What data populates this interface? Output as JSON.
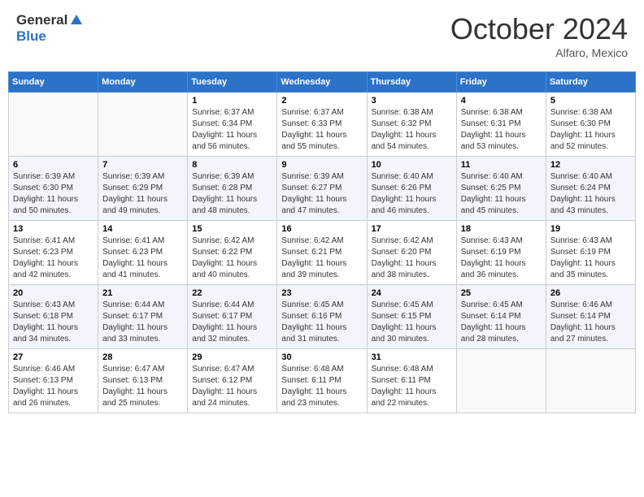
{
  "header": {
    "logo_general": "General",
    "logo_blue": "Blue",
    "month": "October 2024",
    "location": "Alfaro, Mexico"
  },
  "weekdays": [
    "Sunday",
    "Monday",
    "Tuesday",
    "Wednesday",
    "Thursday",
    "Friday",
    "Saturday"
  ],
  "weeks": [
    [
      {
        "day": "",
        "info": ""
      },
      {
        "day": "",
        "info": ""
      },
      {
        "day": "1",
        "sunrise": "6:37 AM",
        "sunset": "6:34 PM",
        "daylight": "11 hours and 56 minutes."
      },
      {
        "day": "2",
        "sunrise": "6:37 AM",
        "sunset": "6:33 PM",
        "daylight": "11 hours and 55 minutes."
      },
      {
        "day": "3",
        "sunrise": "6:38 AM",
        "sunset": "6:32 PM",
        "daylight": "11 hours and 54 minutes."
      },
      {
        "day": "4",
        "sunrise": "6:38 AM",
        "sunset": "6:31 PM",
        "daylight": "11 hours and 53 minutes."
      },
      {
        "day": "5",
        "sunrise": "6:38 AM",
        "sunset": "6:30 PM",
        "daylight": "11 hours and 52 minutes."
      }
    ],
    [
      {
        "day": "6",
        "sunrise": "6:39 AM",
        "sunset": "6:30 PM",
        "daylight": "11 hours and 50 minutes."
      },
      {
        "day": "7",
        "sunrise": "6:39 AM",
        "sunset": "6:29 PM",
        "daylight": "11 hours and 49 minutes."
      },
      {
        "day": "8",
        "sunrise": "6:39 AM",
        "sunset": "6:28 PM",
        "daylight": "11 hours and 48 minutes."
      },
      {
        "day": "9",
        "sunrise": "6:39 AM",
        "sunset": "6:27 PM",
        "daylight": "11 hours and 47 minutes."
      },
      {
        "day": "10",
        "sunrise": "6:40 AM",
        "sunset": "6:26 PM",
        "daylight": "11 hours and 46 minutes."
      },
      {
        "day": "11",
        "sunrise": "6:40 AM",
        "sunset": "6:25 PM",
        "daylight": "11 hours and 45 minutes."
      },
      {
        "day": "12",
        "sunrise": "6:40 AM",
        "sunset": "6:24 PM",
        "daylight": "11 hours and 43 minutes."
      }
    ],
    [
      {
        "day": "13",
        "sunrise": "6:41 AM",
        "sunset": "6:23 PM",
        "daylight": "11 hours and 42 minutes."
      },
      {
        "day": "14",
        "sunrise": "6:41 AM",
        "sunset": "6:23 PM",
        "daylight": "11 hours and 41 minutes."
      },
      {
        "day": "15",
        "sunrise": "6:42 AM",
        "sunset": "6:22 PM",
        "daylight": "11 hours and 40 minutes."
      },
      {
        "day": "16",
        "sunrise": "6:42 AM",
        "sunset": "6:21 PM",
        "daylight": "11 hours and 39 minutes."
      },
      {
        "day": "17",
        "sunrise": "6:42 AM",
        "sunset": "6:20 PM",
        "daylight": "11 hours and 38 minutes."
      },
      {
        "day": "18",
        "sunrise": "6:43 AM",
        "sunset": "6:19 PM",
        "daylight": "11 hours and 36 minutes."
      },
      {
        "day": "19",
        "sunrise": "6:43 AM",
        "sunset": "6:19 PM",
        "daylight": "11 hours and 35 minutes."
      }
    ],
    [
      {
        "day": "20",
        "sunrise": "6:43 AM",
        "sunset": "6:18 PM",
        "daylight": "11 hours and 34 minutes."
      },
      {
        "day": "21",
        "sunrise": "6:44 AM",
        "sunset": "6:17 PM",
        "daylight": "11 hours and 33 minutes."
      },
      {
        "day": "22",
        "sunrise": "6:44 AM",
        "sunset": "6:17 PM",
        "daylight": "11 hours and 32 minutes."
      },
      {
        "day": "23",
        "sunrise": "6:45 AM",
        "sunset": "6:16 PM",
        "daylight": "11 hours and 31 minutes."
      },
      {
        "day": "24",
        "sunrise": "6:45 AM",
        "sunset": "6:15 PM",
        "daylight": "11 hours and 30 minutes."
      },
      {
        "day": "25",
        "sunrise": "6:45 AM",
        "sunset": "6:14 PM",
        "daylight": "11 hours and 28 minutes."
      },
      {
        "day": "26",
        "sunrise": "6:46 AM",
        "sunset": "6:14 PM",
        "daylight": "11 hours and 27 minutes."
      }
    ],
    [
      {
        "day": "27",
        "sunrise": "6:46 AM",
        "sunset": "6:13 PM",
        "daylight": "11 hours and 26 minutes."
      },
      {
        "day": "28",
        "sunrise": "6:47 AM",
        "sunset": "6:13 PM",
        "daylight": "11 hours and 25 minutes."
      },
      {
        "day": "29",
        "sunrise": "6:47 AM",
        "sunset": "6:12 PM",
        "daylight": "11 hours and 24 minutes."
      },
      {
        "day": "30",
        "sunrise": "6:48 AM",
        "sunset": "6:11 PM",
        "daylight": "11 hours and 23 minutes."
      },
      {
        "day": "31",
        "sunrise": "6:48 AM",
        "sunset": "6:11 PM",
        "daylight": "11 hours and 22 minutes."
      },
      {
        "day": "",
        "info": ""
      },
      {
        "day": "",
        "info": ""
      }
    ]
  ],
  "labels": {
    "sunrise": "Sunrise:",
    "sunset": "Sunset:",
    "daylight": "Daylight:"
  }
}
